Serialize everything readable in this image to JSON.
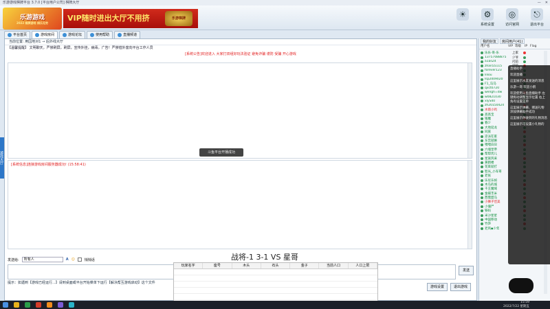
{
  "window": {
    "title": "乐游游戏棋牌平台 3.7.0 [平台用户公司] 棋牌大厅"
  },
  "logo": {
    "text": "乐游游戏",
    "sub": "2022 棋牌游戏 棋乐无穷"
  },
  "banner": {
    "text": "VIP随时进出大厅不用挤",
    "emblem": "乐游棋牌"
  },
  "header_buttons": [
    {
      "label": "",
      "icon": "lightbulb-icon"
    },
    {
      "label": "系统设置",
      "icon": "gear-icon"
    },
    {
      "label": "访问官网",
      "icon": "globe-icon"
    },
    {
      "label": "退出平台",
      "icon": "exit-icon"
    }
  ],
  "tabs": [
    {
      "label": "平台首页"
    },
    {
      "label": "游戏房间"
    },
    {
      "label": "游戏论坛"
    },
    {
      "label": "使用帮助"
    },
    {
      "label": "直播频道"
    }
  ],
  "location": "当前位置: 用园地对1 → 后外线大厅",
  "notice": "【温馨提醒】 文明聊天，严禁刷屏，刷屏，宣传外挂，病毒，广告！严禁借外富向平台工作人员",
  "system_note": "[系统公告]欢迎进入 大家打双组好玩法验证 避免诈骗 谨防 受骗 开心游戏",
  "toast": "斗鱼平台开播成功",
  "chat_line": "[系统信息]连接游戏房间服务器成功! (15:58:41)",
  "send": {
    "to_label": "发送给:",
    "to_value": "所有人",
    "check_label": "悄悄话"
  },
  "send_button": "发送",
  "tip": "提示：如遇到【游戏已经运行...】请到桌面或平台开始菜单下运行【解决帮互游戏启动】这个文件",
  "bottom_buttons": [
    "游戏设置",
    "退出游戏"
  ],
  "vs_text": "战将-1 3-1 VS   星哥",
  "game_grid_headers": [
    "玩家名字",
    "座号",
    "木头",
    "石头",
    "金子",
    "当前人口",
    "人口上限"
  ],
  "sidebar": {
    "tabs": [
      "我的好友",
      "房间用户(41)"
    ],
    "user_headers": [
      "用户名",
      "VIP",
      "等级",
      "IP",
      "Flag"
    ],
    "users": [
      {
        "name": "乐乐·哥·乐",
        "pos": "上家",
        "color": "#0a8c3a"
      },
      {
        "name": "13757088875",
        "pos": "少爷",
        "color": "#0a8c3a"
      },
      {
        "name": "a1asZ4",
        "pos": "闪前",
        "color": "#0a8c3a"
      },
      {
        "name": "zhan55115",
        "pos": "闪前",
        "color": "#0a8c3a"
      },
      {
        "name": "forever123",
        "pos": "",
        "color": "#0a8c3a"
      },
      {
        "name": "liliou",
        "pos": "",
        "color": "#0a8c3a"
      },
      {
        "name": "lsp2009020",
        "pos": "",
        "color": "#0a8c3a"
      },
      {
        "name": "F1_马马",
        "pos": "",
        "color": "#0a8c3a"
      },
      {
        "name": "qxct0720",
        "pos": "",
        "color": "#0a8c3a"
      },
      {
        "name": "wengh=dw",
        "pos": "",
        "color": "#0a8c3a"
      },
      {
        "name": "w0821030",
        "pos": "",
        "color": "#0a8c3a"
      },
      {
        "name": "xlyS40",
        "pos": "",
        "color": "#0a8c3a"
      },
      {
        "name": "zh20150424",
        "pos": "",
        "color": "#0a8c3a"
      },
      {
        "name": "水雨小鸡",
        "pos": "",
        "color": "#e21f1f"
      },
      {
        "name": "高高宝",
        "pos": "",
        "color": "#0a8c3a"
      },
      {
        "name": "银魔",
        "pos": "",
        "color": "#0a8c3a"
      },
      {
        "name": "春少",
        "pos": "",
        "color": "#0a8c3a"
      },
      {
        "name": "大地延龙",
        "pos": "",
        "color": "#0a8c3a"
      },
      {
        "name": "同族",
        "pos": "",
        "color": "#0a8c3a"
      },
      {
        "name": "凉派在家",
        "pos": "",
        "color": "#0a8c3a"
      },
      {
        "name": "东宫就嘛",
        "pos": "",
        "color": "#0a8c3a"
      },
      {
        "name": "嘿嘿白日",
        "pos": "",
        "color": "#0a8c3a"
      },
      {
        "name": "六魂皇帝",
        "pos": "",
        "color": "#0a8c3a"
      },
      {
        "name": "帮帮优儿",
        "pos": "",
        "color": "#0a8c3a"
      },
      {
        "name": "星族风采",
        "pos": "",
        "color": "#0a8c3a"
      },
      {
        "name": "黄鹤楼",
        "pos": "",
        "color": "#0a8c3a"
      },
      {
        "name": "花束就打",
        "pos": "",
        "color": "#0a8c3a"
      },
      {
        "name": "智光_小军哥",
        "pos": "",
        "color": "#0a8c3a"
      },
      {
        "name": "老张",
        "pos": "",
        "color": "#0a8c3a"
      },
      {
        "name": "乐尼乐如",
        "pos": "",
        "color": "#0a8c3a"
      },
      {
        "name": "木马的城",
        "pos": "",
        "color": "#0a8c3a"
      },
      {
        "name": "千王魔域",
        "pos": "",
        "color": "#0a8c3a"
      },
      {
        "name": "金碟丰米",
        "pos": "",
        "color": "#0a8c3a"
      },
      {
        "name": "西需盟马",
        "pos": "",
        "color": "#0a8c3a"
      },
      {
        "name": "小狮子佳美",
        "pos": "",
        "color": "#e21f1f"
      },
      {
        "name": "小僵尸",
        "pos": "",
        "color": "#0a8c3a"
      },
      {
        "name": "铁码",
        "pos": "",
        "color": "#0a8c3a"
      },
      {
        "name": "米沙星星",
        "pos": "",
        "color": "#0a8c3a"
      },
      {
        "name": "中国移动",
        "pos": "",
        "color": "#0a8c3a"
      },
      {
        "name": "竹笋",
        "pos": "",
        "color": "#0a8c3a"
      },
      {
        "name": "老风◆少年",
        "pos": "",
        "color": "#0a8c3a"
      }
    ]
  },
  "overlay": [
    "直播助手",
    "欢迎直播",
    "这里展示水友发送的消息",
    "乐游一哥 欢迎小鹤",
    "欢迎使用斗鱼直播助手 左键拖动调整显示位置 右上角有设置菜单",
    "这里展示弹幕、赠送礼物 添加弹幕助手成功",
    "这里展示你收到的礼物消息",
    "这里展示可设置小礼物的"
  ],
  "clock": {
    "time": "15:59",
    "date": "2022/7/22 星期五"
  },
  "left_strip": "游戏大厅"
}
